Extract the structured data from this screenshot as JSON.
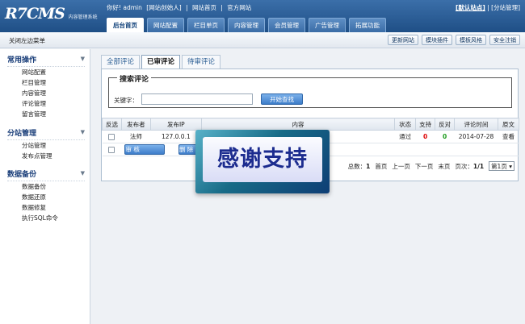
{
  "header": {
    "logo_main": "R7CMS",
    "logo_sub": "内容管理系统",
    "greeting": "你好! admin",
    "role": "[网站创始人]",
    "links": [
      "网站首页",
      "官方网站"
    ],
    "site_default": "[默认站点]",
    "site_manage": "[分站管理]",
    "nav": [
      "后台首页",
      "网站配置",
      "栏目单页",
      "内容管理",
      "会员管理",
      "广告管理",
      "拓展功能"
    ]
  },
  "subbar": {
    "close_left": "关闭左边菜单",
    "buttons": [
      "更新网站",
      "模块插件",
      "模板风格",
      "安全注销"
    ]
  },
  "sidebar": {
    "sections": [
      {
        "title": "常用操作",
        "items": [
          "网站配置",
          "栏目管理",
          "内容管理",
          "评论管理",
          "留言管理"
        ]
      },
      {
        "title": "分站管理",
        "items": [
          "分站管理",
          "发布点管理"
        ]
      },
      {
        "title": "数据备份",
        "items": [
          "数据备份",
          "数据还原",
          "数据修复",
          "执行SQL命令"
        ]
      }
    ]
  },
  "main": {
    "tabs": [
      "全部评论",
      "已审评论",
      "待审评论"
    ],
    "active_tab": 1,
    "search": {
      "legend": "搜索评论",
      "keyword_label": "关键字：",
      "button": "开始查找"
    },
    "table": {
      "columns": [
        "反选",
        "发布者",
        "发布IP",
        "内容",
        "状态",
        "支持",
        "反对",
        "评论时间",
        "原文"
      ],
      "rows": [
        {
          "author": "法师",
          "ip": "127.0.0.1",
          "content": "",
          "status": "通过",
          "support": "0",
          "oppose": "0",
          "time": "2014-07-28",
          "view": "查看"
        }
      ],
      "actions": [
        "审 核",
        "删 除"
      ]
    },
    "pager": {
      "total_label": "总数：",
      "total": "1",
      "first": "首页",
      "prev": "上一页",
      "next": "下一页",
      "last": "末页",
      "pages_label": "页次：",
      "pages": "1/1",
      "select": "第1页"
    }
  },
  "overlay": {
    "text": "感谢支持"
  }
}
